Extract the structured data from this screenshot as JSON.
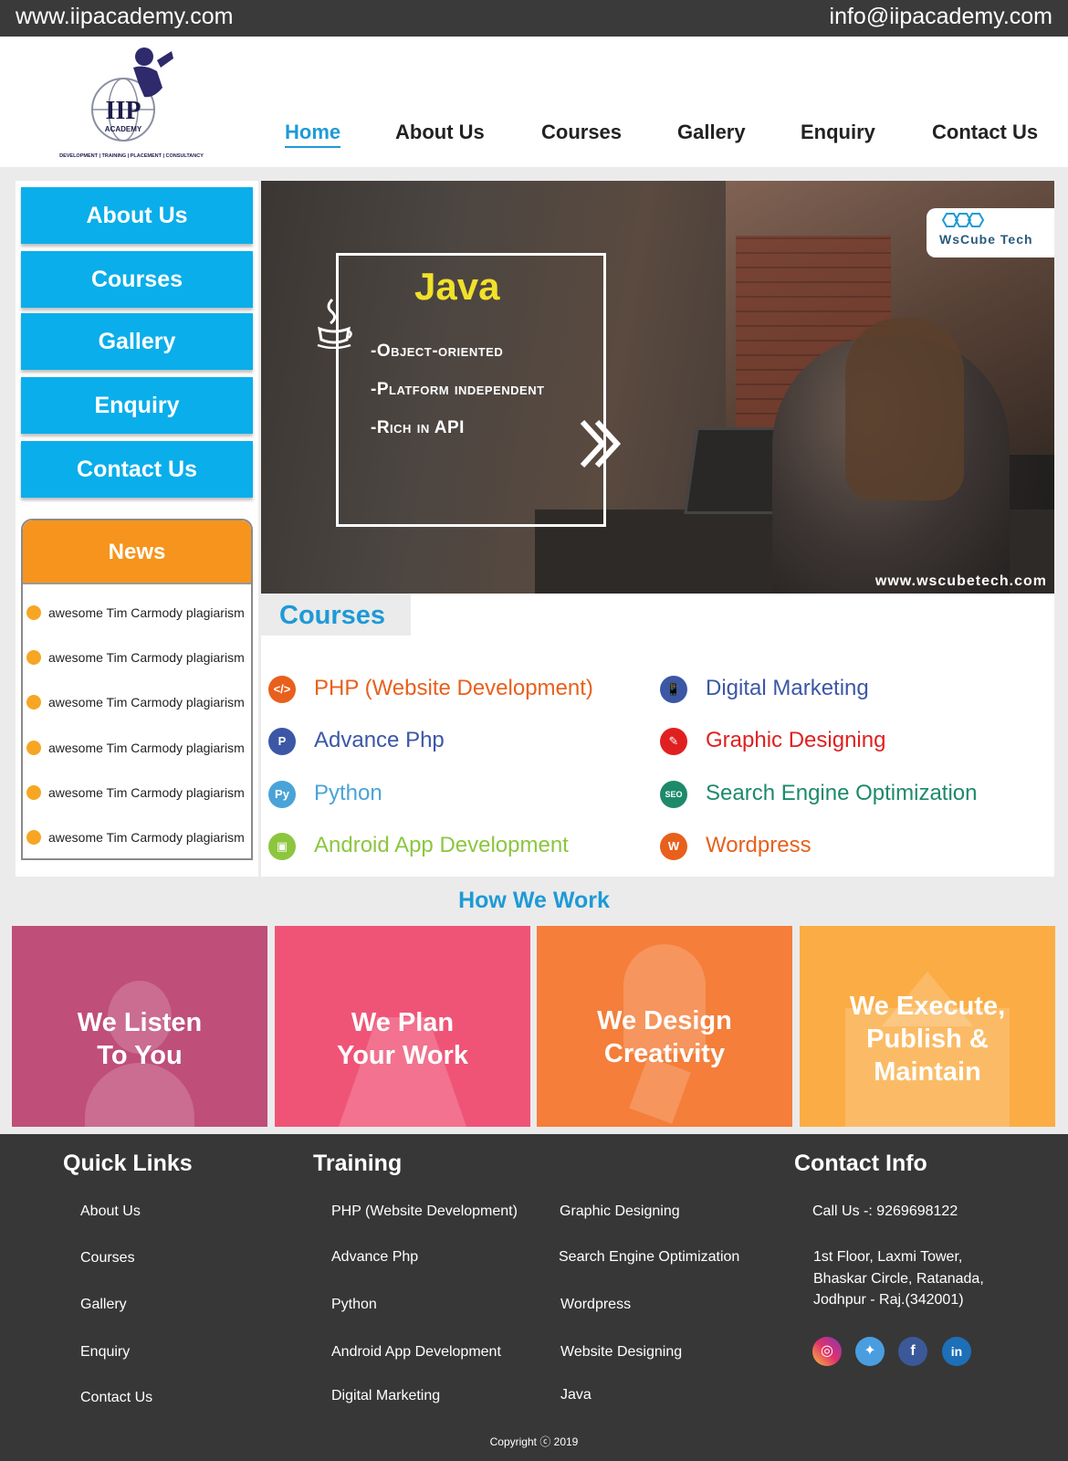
{
  "topbar": {
    "website": "www.iipacademy.com",
    "email": "info@iipacademy.com"
  },
  "logo": {
    "brand": "IIP",
    "sub": "ACADEMY",
    "tagline": "DEVELOPMENT | TRAINING | PLACEMENT | CONSULTANCY"
  },
  "nav": [
    "Home",
    "About Us",
    "Courses",
    "Gallery",
    "Enquiry",
    "Contact Us"
  ],
  "sidebar": {
    "buttons": [
      "About Us",
      "Courses",
      "Gallery",
      "Enquiry",
      "Contact Us"
    ]
  },
  "news": {
    "title": "News",
    "items": [
      "awesome Tim Carmody plagiarism",
      "awesome Tim Carmody plagiarism",
      "awesome Tim Carmody plagiarism",
      "awesome Tim Carmody plagiarism",
      "awesome Tim Carmody plagiarism",
      "awesome Tim Carmody plagiarism"
    ]
  },
  "hero": {
    "title": "Java",
    "lines": [
      "-Object-oriented",
      "-Platform independent",
      "-Rich in API"
    ],
    "badge": "WsCube Tech",
    "url": "www.wscubetech.com"
  },
  "courses": {
    "title": "Courses",
    "items": [
      {
        "label": "PHP (Website Development)",
        "color": "#e8601c",
        "icon": "php-code-icon"
      },
      {
        "label": "Digital Marketing",
        "color": "#3b57a6",
        "icon": "digital-marketing-icon"
      },
      {
        "label": "Advance Php",
        "color": "#3b57a6",
        "icon": "advance-php-icon"
      },
      {
        "label": "Graphic Designing",
        "color": "#e02020",
        "icon": "graphic-design-icon"
      },
      {
        "label": "Python",
        "color": "#4aa3d8",
        "icon": "python-icon"
      },
      {
        "label": "Search Engine Optimization",
        "color": "#1d8a6a",
        "icon": "seo-icon"
      },
      {
        "label": "Android App Development",
        "color": "#8cc63f",
        "icon": "android-icon"
      },
      {
        "label": "Wordpress",
        "color": "#e8601c",
        "icon": "wordpress-icon"
      }
    ]
  },
  "how_we_work": {
    "title": "How We Work",
    "cards": [
      {
        "text": "We Listen\nTo You",
        "color": "#bf4e78"
      },
      {
        "text": "We Plan\nYour Work",
        "color": "#ef5477"
      },
      {
        "text": "We Design\nCreativity",
        "color": "#f47e3a"
      },
      {
        "text": "We Execute,\nPublish &\nMaintain",
        "color": "#fbac45"
      }
    ]
  },
  "footer": {
    "quick_links_title": "Quick Links",
    "quick_links": [
      "About Us",
      "Courses",
      "Gallery",
      "Enquiry",
      "Contact Us"
    ],
    "training_title": "Training",
    "training_col1": [
      "PHP (Website Development)",
      "Advance Php",
      "Python",
      "Android App Development",
      "Digital Marketing"
    ],
    "training_col2": [
      "Graphic Designing",
      "Search Engine Optimization",
      "Wordpress",
      "Website Designing",
      "Java"
    ],
    "contact_title": "Contact Info",
    "phone": "Call Us -: 9269698122",
    "address": [
      "1st Floor, Laxmi Tower,",
      "Bhaskar Circle, Ratanada,",
      "Jodhpur - Raj.(342001)"
    ],
    "social": [
      "instagram-icon",
      "twitter-icon",
      "facebook-icon",
      "linkedin-icon"
    ],
    "copyright": "Copyright ⓒ 2019"
  }
}
